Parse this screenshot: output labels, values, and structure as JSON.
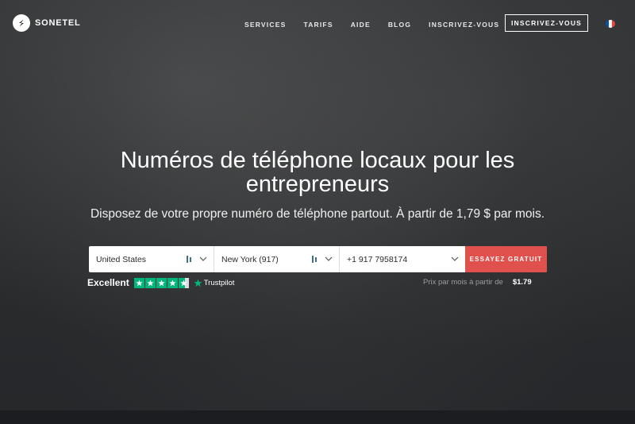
{
  "brand": {
    "name": "SONETEL"
  },
  "nav": {
    "items": [
      {
        "label": "SERVICES"
      },
      {
        "label": "TARIFS"
      },
      {
        "label": "AIDE"
      },
      {
        "label": "BLOG"
      },
      {
        "label": "INSCRIVEZ-VOUS"
      }
    ],
    "cta_label": "INSCRIVEZ-VOUS",
    "language_flag": "france-flag-icon"
  },
  "hero": {
    "title": "Numéros de téléphone locaux pour les entrepreneurs",
    "subtitle": "Disposez de votre propre numéro de téléphone partout. À partir de 1,79 $ par mois."
  },
  "search": {
    "country": "United States",
    "city": "New York (917)",
    "number": "+1 917 7958174",
    "cta_label": "ESSAYEZ GRATUIT"
  },
  "rating": {
    "word": "Excellent",
    "stars": 4.5,
    "provider": "Trustpilot"
  },
  "price": {
    "label": "Prix par mois à partir de",
    "value": "$1.79"
  },
  "colors": {
    "accent": "#e0504c",
    "trustpilot_green": "#00b67a"
  }
}
